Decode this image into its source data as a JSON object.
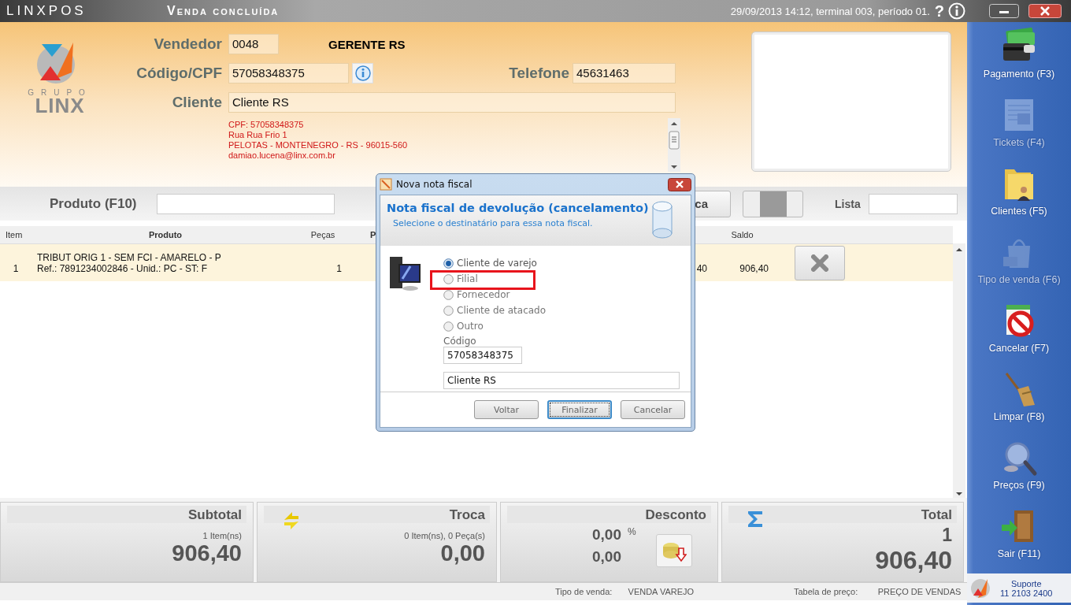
{
  "title_bar": {
    "app_name": "LINXPOS",
    "screen_title": "Venda concluída",
    "session_info": "29/09/2013 14:12, terminal 003, período 01.",
    "help_glyph": "?"
  },
  "logo": {
    "tagline": "GRUPO",
    "name": "LINX"
  },
  "customer": {
    "seller_label": "Vendedor",
    "seller_code": "0048",
    "seller_name": "GERENTE RS",
    "code_label": "Código/CPF",
    "code_value": "57058348375",
    "phone_label": "Telefone",
    "phone_value": "45631463",
    "client_label": "Cliente",
    "client_value": "Cliente RS",
    "details": [
      "CPF: 57058348375",
      "Rua Rua Frio 1",
      "PELOTAS - MONTENEGRO - RS - 96015-560",
      "damiao.lucena@linx.com.br"
    ]
  },
  "product_bar": {
    "label": "Produto (F10)",
    "exchange_button": "ca",
    "list_label": "Lista"
  },
  "table": {
    "columns": [
      "Item",
      "Produto",
      "Peças",
      "P",
      "",
      "Saldo"
    ],
    "rows": [
      {
        "item": "1",
        "product_lines": [
          "TRIBUT ORIG 1 - SEM FCI - AMARELO - P",
          "Ref.: 7891234002846 - Unid.: PC - ST: F"
        ],
        "pieces": "1",
        "column_5": "40",
        "balance": "906,40"
      }
    ]
  },
  "summary": [
    {
      "kind": "subtotal",
      "label": "Subtotal",
      "count": "1 Item(ns)",
      "value": "906,40"
    },
    {
      "kind": "exchange",
      "label": "Troca",
      "count": "0 Item(ns), 0 Peça(s)",
      "value": "0,00"
    },
    {
      "kind": "discount",
      "label": "Desconto",
      "percent": "0,00",
      "percent_sign": "%",
      "value": "0,00"
    },
    {
      "kind": "total",
      "label": "Total",
      "count": "1",
      "value": "906,40"
    }
  ],
  "status_bar": [
    {
      "label": "Tipo de venda:",
      "value": "VENDA VAREJO"
    },
    {
      "label": "Tabela de preço:",
      "value": "PREÇO DE VENDAS"
    }
  ],
  "sidebar": {
    "items": [
      {
        "label": "Pagamento (F3)",
        "disabled": false
      },
      {
        "label": "Tickets (F4)",
        "disabled": true
      },
      {
        "label": "Clientes (F5)",
        "disabled": false
      },
      {
        "label": "Tipo de venda (F6)",
        "disabled": true
      },
      {
        "label": "Cancelar (F7)",
        "disabled": false
      },
      {
        "label": "Limpar (F8)",
        "disabled": false
      },
      {
        "label": "Preços (F9)",
        "disabled": false
      },
      {
        "label": "Sair (F11)",
        "disabled": false
      }
    ],
    "support": {
      "label": "Suporte",
      "phone": "11 2103 2400"
    }
  },
  "dialog": {
    "title": "Nova nota fiscal",
    "heading": "Nota fiscal de devolução (cancelamento)",
    "subtitle": "Selecione o destinatário para essa nota fiscal.",
    "options": [
      {
        "label": "Cliente de varejo",
        "selected": true,
        "highlighted": false
      },
      {
        "label": "Filial",
        "selected": false,
        "highlighted": true
      },
      {
        "label": "Fornecedor",
        "selected": false,
        "highlighted": false
      },
      {
        "label": "Cliente de atacado",
        "selected": false,
        "highlighted": false
      },
      {
        "label": "Outro",
        "selected": false,
        "highlighted": false
      }
    ],
    "code_label": "Código",
    "code_value": "57058348375",
    "name_value": "Cliente RS",
    "buttons": [
      {
        "label": "Voltar",
        "default": false
      },
      {
        "label": "Finalizar",
        "default": true
      },
      {
        "label": "Cancelar",
        "default": false
      }
    ]
  }
}
